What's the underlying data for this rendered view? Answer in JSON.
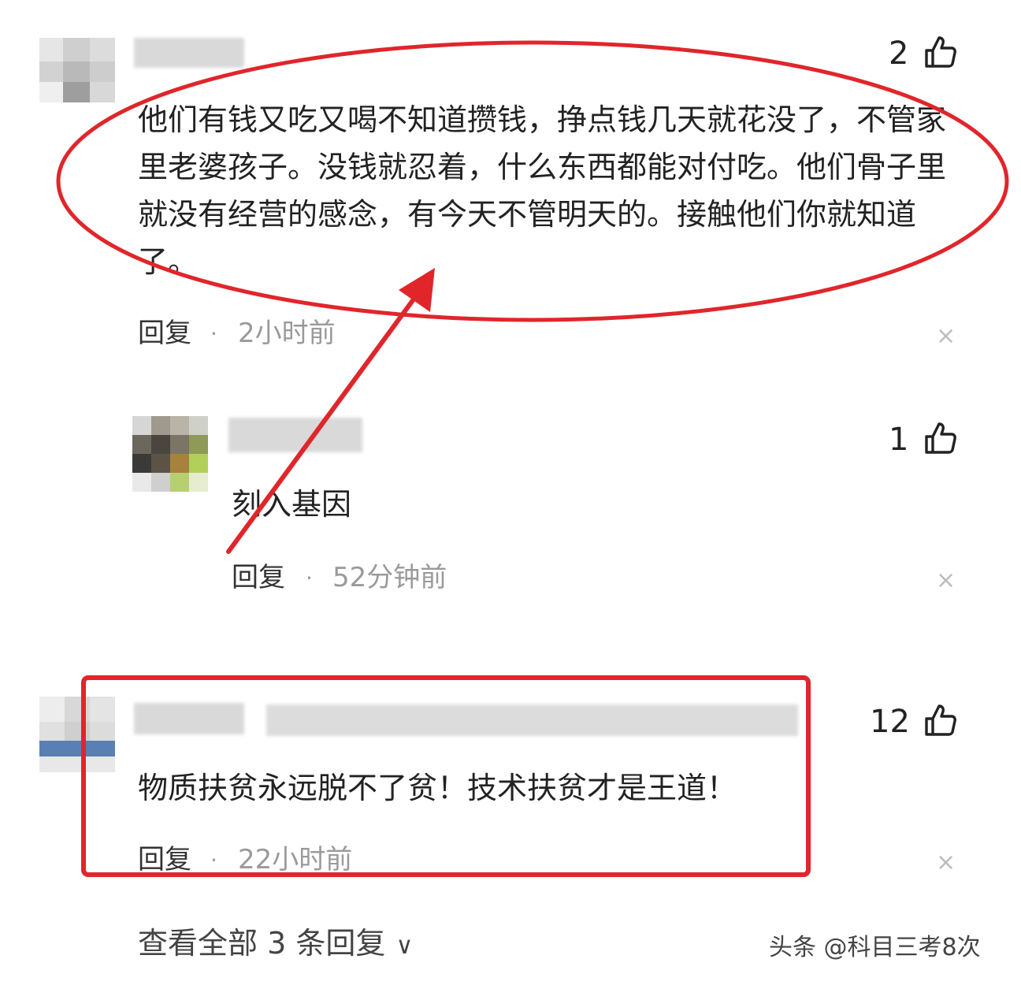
{
  "comments": [
    {
      "likes": "2",
      "text": "他们有钱又吃又喝不知道攒钱，挣点钱几天就花没了，不管家里老婆孩子。没钱就忍着，什么东西都能对付吃。他们骨子里就没有经营的感念，有今天不管明天的。接触他们你就知道了。",
      "reply_label": "回复",
      "separator": "·",
      "time": "2小时前"
    },
    {
      "likes": "1",
      "text": "刻入基因",
      "reply_label": "回复",
      "separator": "·",
      "time": "52分钟前"
    },
    {
      "likes": "12",
      "text": "物质扶贫永远脱不了贫！技术扶贫才是王道！",
      "reply_label": "回复",
      "separator": "·",
      "time": "22小时前"
    }
  ],
  "close_glyph": "×",
  "view_all": "查看全部 3 条回复",
  "view_all_chevron": "∨",
  "watermark": "头条 @科目三考8次",
  "colors": {
    "annotation_red": "#e0262b",
    "text": "#222222",
    "muted": "#9a9a9a"
  },
  "icons": [
    "thumbs-up-icon",
    "close-icon",
    "chevron-down-icon"
  ]
}
